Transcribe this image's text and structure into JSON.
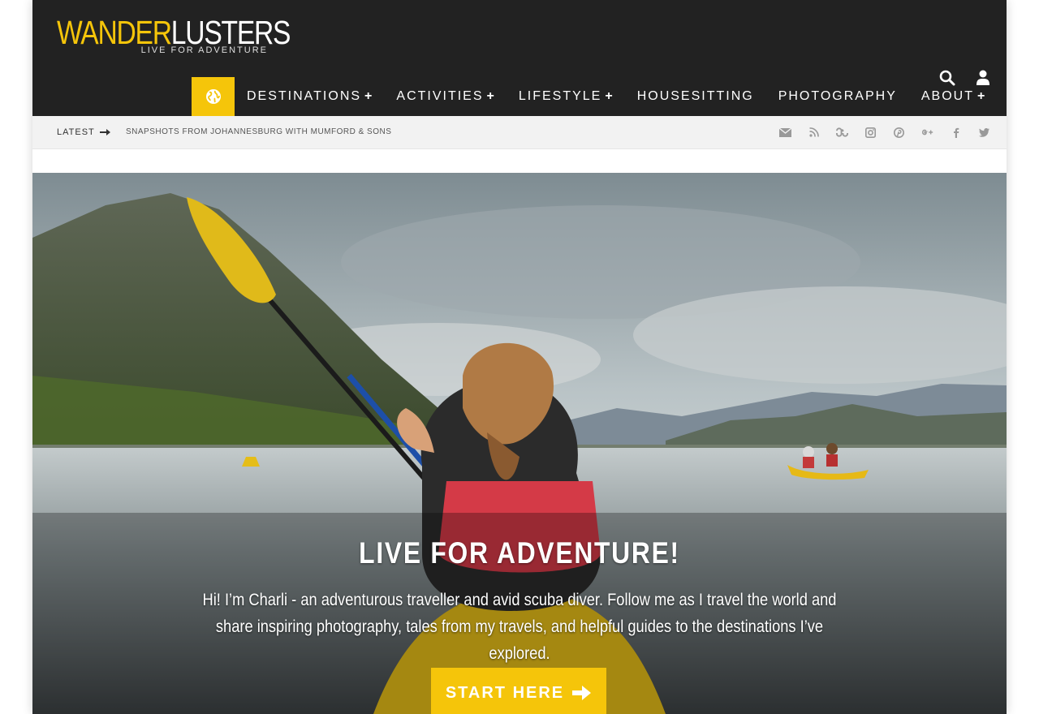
{
  "logo": {
    "part1": "WANDER",
    "part2": "LUSTERS",
    "tagline": "LIVE FOR ADVENTURE",
    "accent_color": "#f5c50a"
  },
  "header_icons": [
    "search-icon",
    "user-icon"
  ],
  "nav": {
    "home_icon": "globe-icon",
    "items": [
      {
        "label": "DESTINATIONS",
        "has_submenu": true
      },
      {
        "label": "ACTIVITIES",
        "has_submenu": true
      },
      {
        "label": "LIFESTYLE",
        "has_submenu": true
      },
      {
        "label": "HOUSESITTING",
        "has_submenu": false
      },
      {
        "label": "PHOTOGRAPHY",
        "has_submenu": false
      },
      {
        "label": "ABOUT",
        "has_submenu": true
      }
    ]
  },
  "ticker": {
    "label": "LATEST",
    "headline": "SNAPSHOTS FROM JOHANNESBURG WITH MUMFORD & SONS"
  },
  "social_icons": [
    "envelope-icon",
    "rss-icon",
    "stumbleupon-icon",
    "instagram-icon",
    "pinterest-icon",
    "google-plus-icon",
    "facebook-icon",
    "twitter-icon"
  ],
  "hero": {
    "title": "LIVE FOR ADVENTURE!",
    "text": "Hi! I’m Charli - an adventurous traveller and avid scuba diver. Follow me as I travel the world and share inspiring photography, tales from my travels, and helpful guides to the destinations I’ve explored.",
    "button_label": "START HERE",
    "button_color": "#f5c50a"
  }
}
